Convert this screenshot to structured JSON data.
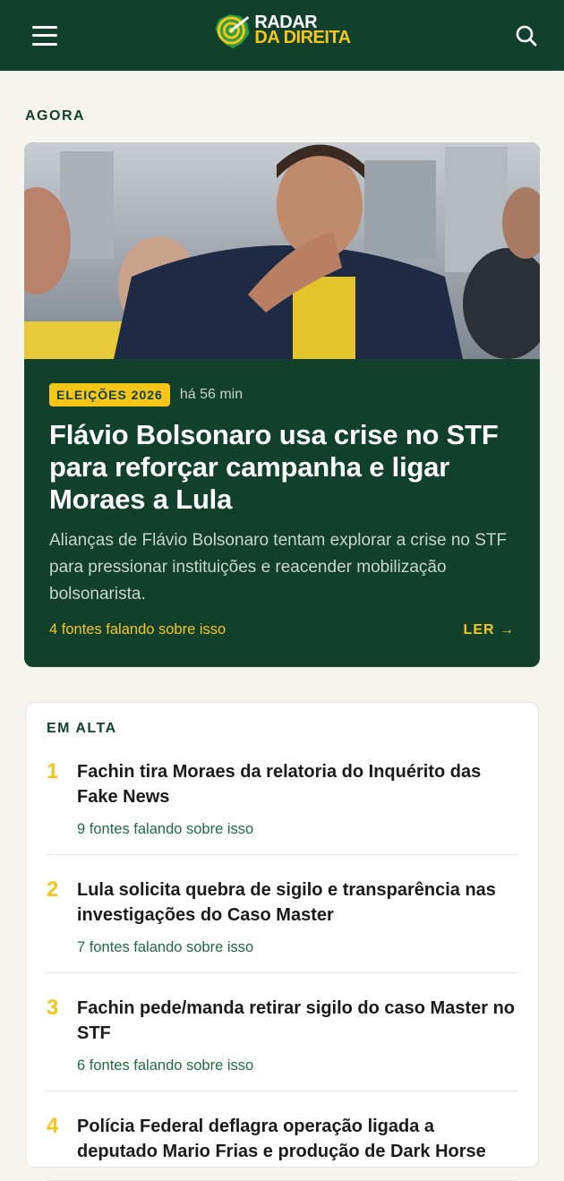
{
  "header": {
    "logo_line1": "RADAR",
    "logo_line2": "DA DIREITA"
  },
  "agora": {
    "section_label": "AGORA",
    "tag": "ELEIÇÕES 2026",
    "time": "há 56 min",
    "title": "Flávio Bolsonaro usa crise no STF para reforçar campanha e ligar Moraes a Lula",
    "description": "Alianças de Flávio Bolsonaro tentam explorar a crise no STF para pressionar instituições e reacender mobilização bolsonarista.",
    "sources": "4 fontes falando sobre isso",
    "read_label": "LER →"
  },
  "trending": {
    "section_label": "EM ALTA",
    "items": [
      {
        "rank": "1",
        "title": "Fachin tira Moraes da relatoria do Inquérito das Fake News",
        "sources": "9 fontes falando sobre isso"
      },
      {
        "rank": "2",
        "title": "Lula solicita quebra de sigilo e transparência nas investigações do Caso Master",
        "sources": "7 fontes falando sobre isso"
      },
      {
        "rank": "3",
        "title": "Fachin pede/manda retirar sigilo do caso Master no STF",
        "sources": "6 fontes falando sobre isso"
      },
      {
        "rank": "4",
        "title": "Polícia Federal deflagra operação ligada a deputado Mario Frias e produção de Dark Horse",
        "sources": ""
      }
    ]
  },
  "colors": {
    "brand_green": "#11402c",
    "accent_yellow": "#f5c518",
    "link_green": "#1d6b45"
  }
}
